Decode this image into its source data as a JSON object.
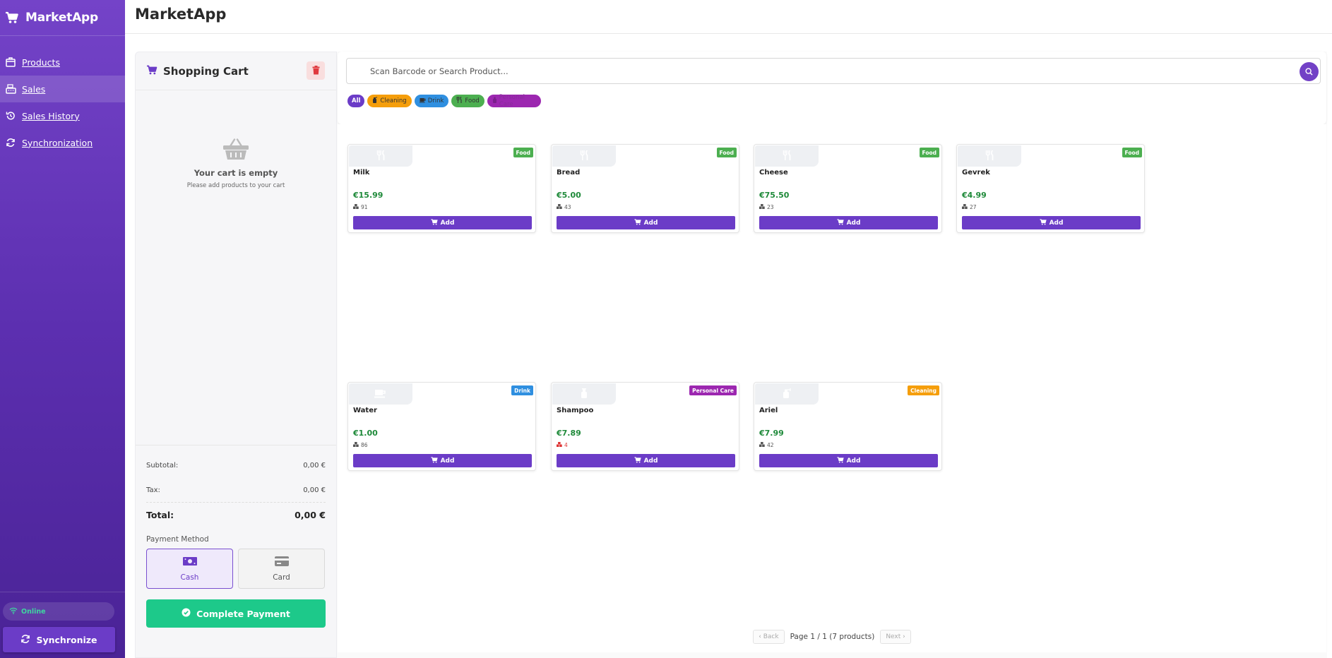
{
  "app": {
    "name": "MarketApp",
    "title": "MarketApp"
  },
  "sidebar": {
    "items": [
      {
        "label": "Products",
        "icon": "box-icon"
      },
      {
        "label": "Sales",
        "icon": "cash-register-icon",
        "active": true
      },
      {
        "label": "Sales History",
        "icon": "history-icon"
      },
      {
        "label": "Synchronization",
        "icon": "sync-icon"
      }
    ],
    "status": "Online",
    "sync_label": "Synchronize"
  },
  "cart": {
    "title": "Shopping Cart",
    "empty_title": "Your cart is empty",
    "empty_sub": "Please add products to your cart",
    "subtotal_label": "Subtotal:",
    "subtotal": "0,00 €",
    "tax_label": "Tax:",
    "tax": "0,00 €",
    "total_label": "Total:",
    "total": "0,00 €",
    "payment_label": "Payment Method",
    "cash_label": "Cash",
    "card_label": "Card",
    "selected_payment": "Cash",
    "pay_label": "Complete Payment"
  },
  "search": {
    "placeholder": "Scan Barcode or Search Product..."
  },
  "filters": [
    {
      "label": "All",
      "color": "#6b3cc7",
      "active": true
    },
    {
      "label": "Cleaning",
      "color": "#f59e0b"
    },
    {
      "label": "Drink",
      "color": "#2f8fe0"
    },
    {
      "label": "Food",
      "color": "#4caf50"
    },
    {
      "label": "Personal Care",
      "color": "#9c27b0"
    }
  ],
  "products": [
    {
      "name": "Milk",
      "price": "€15.99",
      "stock": "91",
      "category": "Food",
      "badge_color": "#4caf50",
      "icon": "utensils-icon"
    },
    {
      "name": "Bread",
      "price": "€5.00",
      "stock": "43",
      "category": "Food",
      "badge_color": "#4caf50",
      "icon": "utensils-icon"
    },
    {
      "name": "Cheese",
      "price": "€75.50",
      "stock": "23",
      "category": "Food",
      "badge_color": "#4caf50",
      "icon": "utensils-icon"
    },
    {
      "name": "Gevrek",
      "price": "€4.99",
      "stock": "27",
      "category": "Food",
      "badge_color": "#4caf50",
      "icon": "utensils-icon"
    },
    {
      "name": "Water",
      "price": "€1.00",
      "stock": "86",
      "category": "Drink",
      "badge_color": "#2f8fe0",
      "icon": "cup-icon"
    },
    {
      "name": "Shampoo",
      "price": "€7.89",
      "stock": "4",
      "category": "Personal Care",
      "badge_color": "#9c27b0",
      "icon": "bottle-icon",
      "low_stock": true
    },
    {
      "name": "Ariel",
      "price": "€7.99",
      "stock": "42",
      "category": "Cleaning",
      "badge_color": "#f59e0b",
      "icon": "spray-icon"
    }
  ],
  "add_label": "Add",
  "pagination": {
    "back": "Back",
    "info": "Page 1 / 1 (7 products)",
    "next": "Next"
  }
}
